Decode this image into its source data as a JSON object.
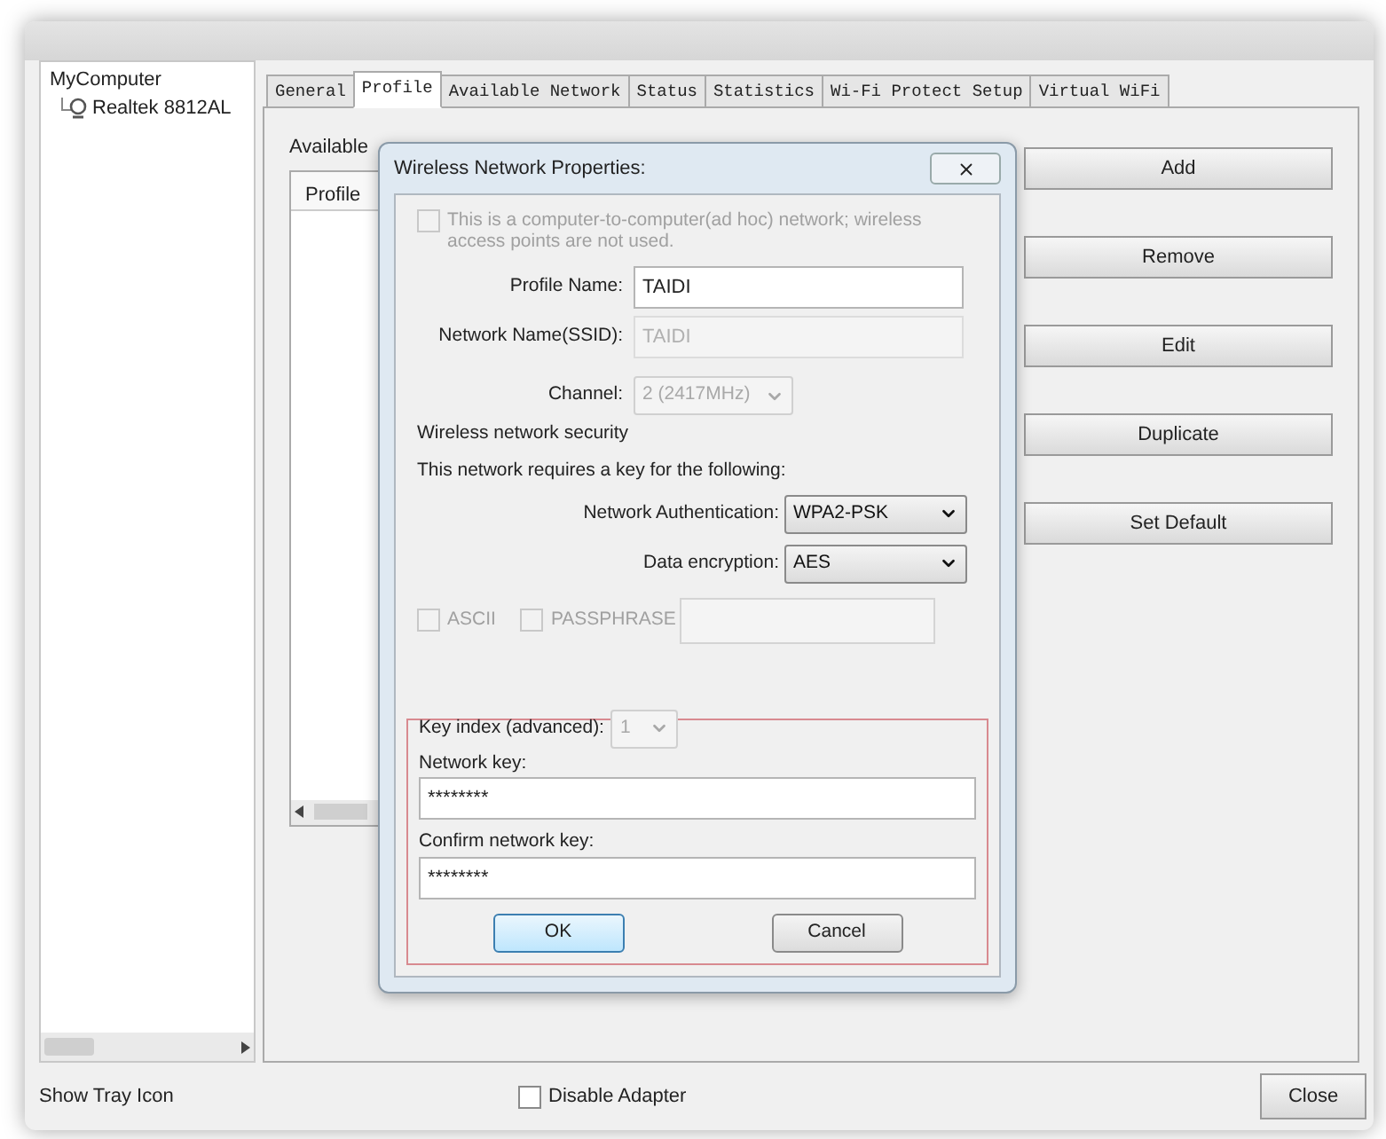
{
  "tree": [
    {
      "label": "MyComputer",
      "children": [
        {
          "label": "Realtek 8812AL"
        }
      ]
    }
  ],
  "tabs": [
    {
      "label": "General",
      "selected": false
    },
    {
      "label": "Profile",
      "selected": true
    },
    {
      "label": "Available Network",
      "selected": false
    },
    {
      "label": "Status",
      "selected": false
    },
    {
      "label": "Statistics",
      "selected": false
    },
    {
      "label": "Wi-Fi Protect Setup",
      "selected": false
    },
    {
      "label": "Virtual WiFi",
      "selected": false
    }
  ],
  "profiles": {
    "label": "Available",
    "column_1": "Profile"
  },
  "buttons": [
    "Add",
    "Remove",
    "Edit",
    "Duplicate",
    "Set Default"
  ],
  "footer": {
    "tray": "Show Tray Icon",
    "disable_adapter": {
      "label": "Disable Adapter",
      "checked": false,
      "disabled": false
    },
    "close": "Close"
  },
  "dialog": {
    "title": "Wireless Network Properties:",
    "adhoc": {
      "label": "This is a computer-to-computer(ad hoc) network; wireless access points are not used.",
      "checked": false,
      "disabled": true
    },
    "profile_name": {
      "label": "Profile Name:",
      "value": "TAIDI",
      "disabled": false
    },
    "ssid": {
      "label": "Network Name(SSID):",
      "value": "TAIDI",
      "disabled": true
    },
    "channel": {
      "label": "Channel:",
      "value": "2 (2417MHz)",
      "disabled": true
    },
    "security_heading": "Wireless network security",
    "security_note": "This network requires a key for the following:",
    "authentication": {
      "label": "Network Authentication:",
      "value": "WPA2-PSK",
      "disabled": false
    },
    "encryption": {
      "label": "Data encryption:",
      "value": "AES",
      "disabled": false
    },
    "ascii": {
      "label": "ASCII",
      "checked": false,
      "disabled": true
    },
    "passphrase": {
      "label": "PASSPHRASE",
      "checked": false,
      "disabled": true
    },
    "key_index": {
      "label": "Key index (advanced):",
      "value": "1",
      "disabled": true
    },
    "network_key": {
      "label": "Network key:",
      "value": "********",
      "disabled": false
    },
    "confirm_key": {
      "label": "Confirm network key:",
      "value": "********",
      "disabled": false
    },
    "ok": "OK",
    "cancel": "Cancel"
  }
}
